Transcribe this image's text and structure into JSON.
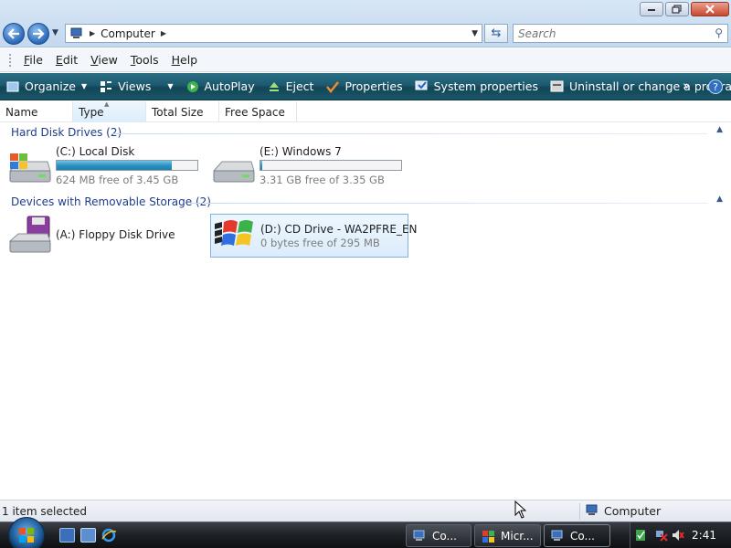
{
  "nav": {
    "address_text": "Computer",
    "search_placeholder": "Search"
  },
  "menu": {
    "items": [
      {
        "ul": "F",
        "rest": "ile"
      },
      {
        "ul": "E",
        "rest": "dit"
      },
      {
        "ul": "V",
        "rest": "iew"
      },
      {
        "ul": "T",
        "rest": "ools"
      },
      {
        "ul": "H",
        "rest": "elp"
      }
    ]
  },
  "commands": {
    "organize": "Organize",
    "views": "Views",
    "autoplay": "AutoPlay",
    "eject": "Eject",
    "properties": "Properties",
    "system_properties": "System properties",
    "uninstall": "Uninstall or change a program",
    "more": "»",
    "help": "?"
  },
  "columns": [
    "Name",
    "Type",
    "Total Size",
    "Free Space"
  ],
  "groups": {
    "hard_disks": "Hard Disk Drives (2)",
    "removable": "Devices with Removable Storage (2)"
  },
  "drives": {
    "c": {
      "name": "(C:) Local Disk",
      "free": "624 MB free of 3.45 GB",
      "used_fraction": 0.82
    },
    "e": {
      "name": "(E:) Windows 7",
      "free": "3.31 GB free of 3.35 GB",
      "used_fraction": 0.01
    },
    "a": {
      "name": "(A:) Floppy Disk Drive"
    },
    "d": {
      "name": "(D:) CD Drive - WA2PFRE_EN",
      "free": "0 bytes free of 295 MB"
    }
  },
  "status": {
    "selection": "1 item selected",
    "location": "Computer"
  },
  "taskbar": {
    "buttons": [
      "Co...",
      "Micr...",
      "Co..."
    ],
    "clock": "2:41"
  },
  "colors": {
    "command_bar": "#1c5a70",
    "group_title": "#1e3c8c",
    "bar_fill": "#2a8fbd"
  }
}
